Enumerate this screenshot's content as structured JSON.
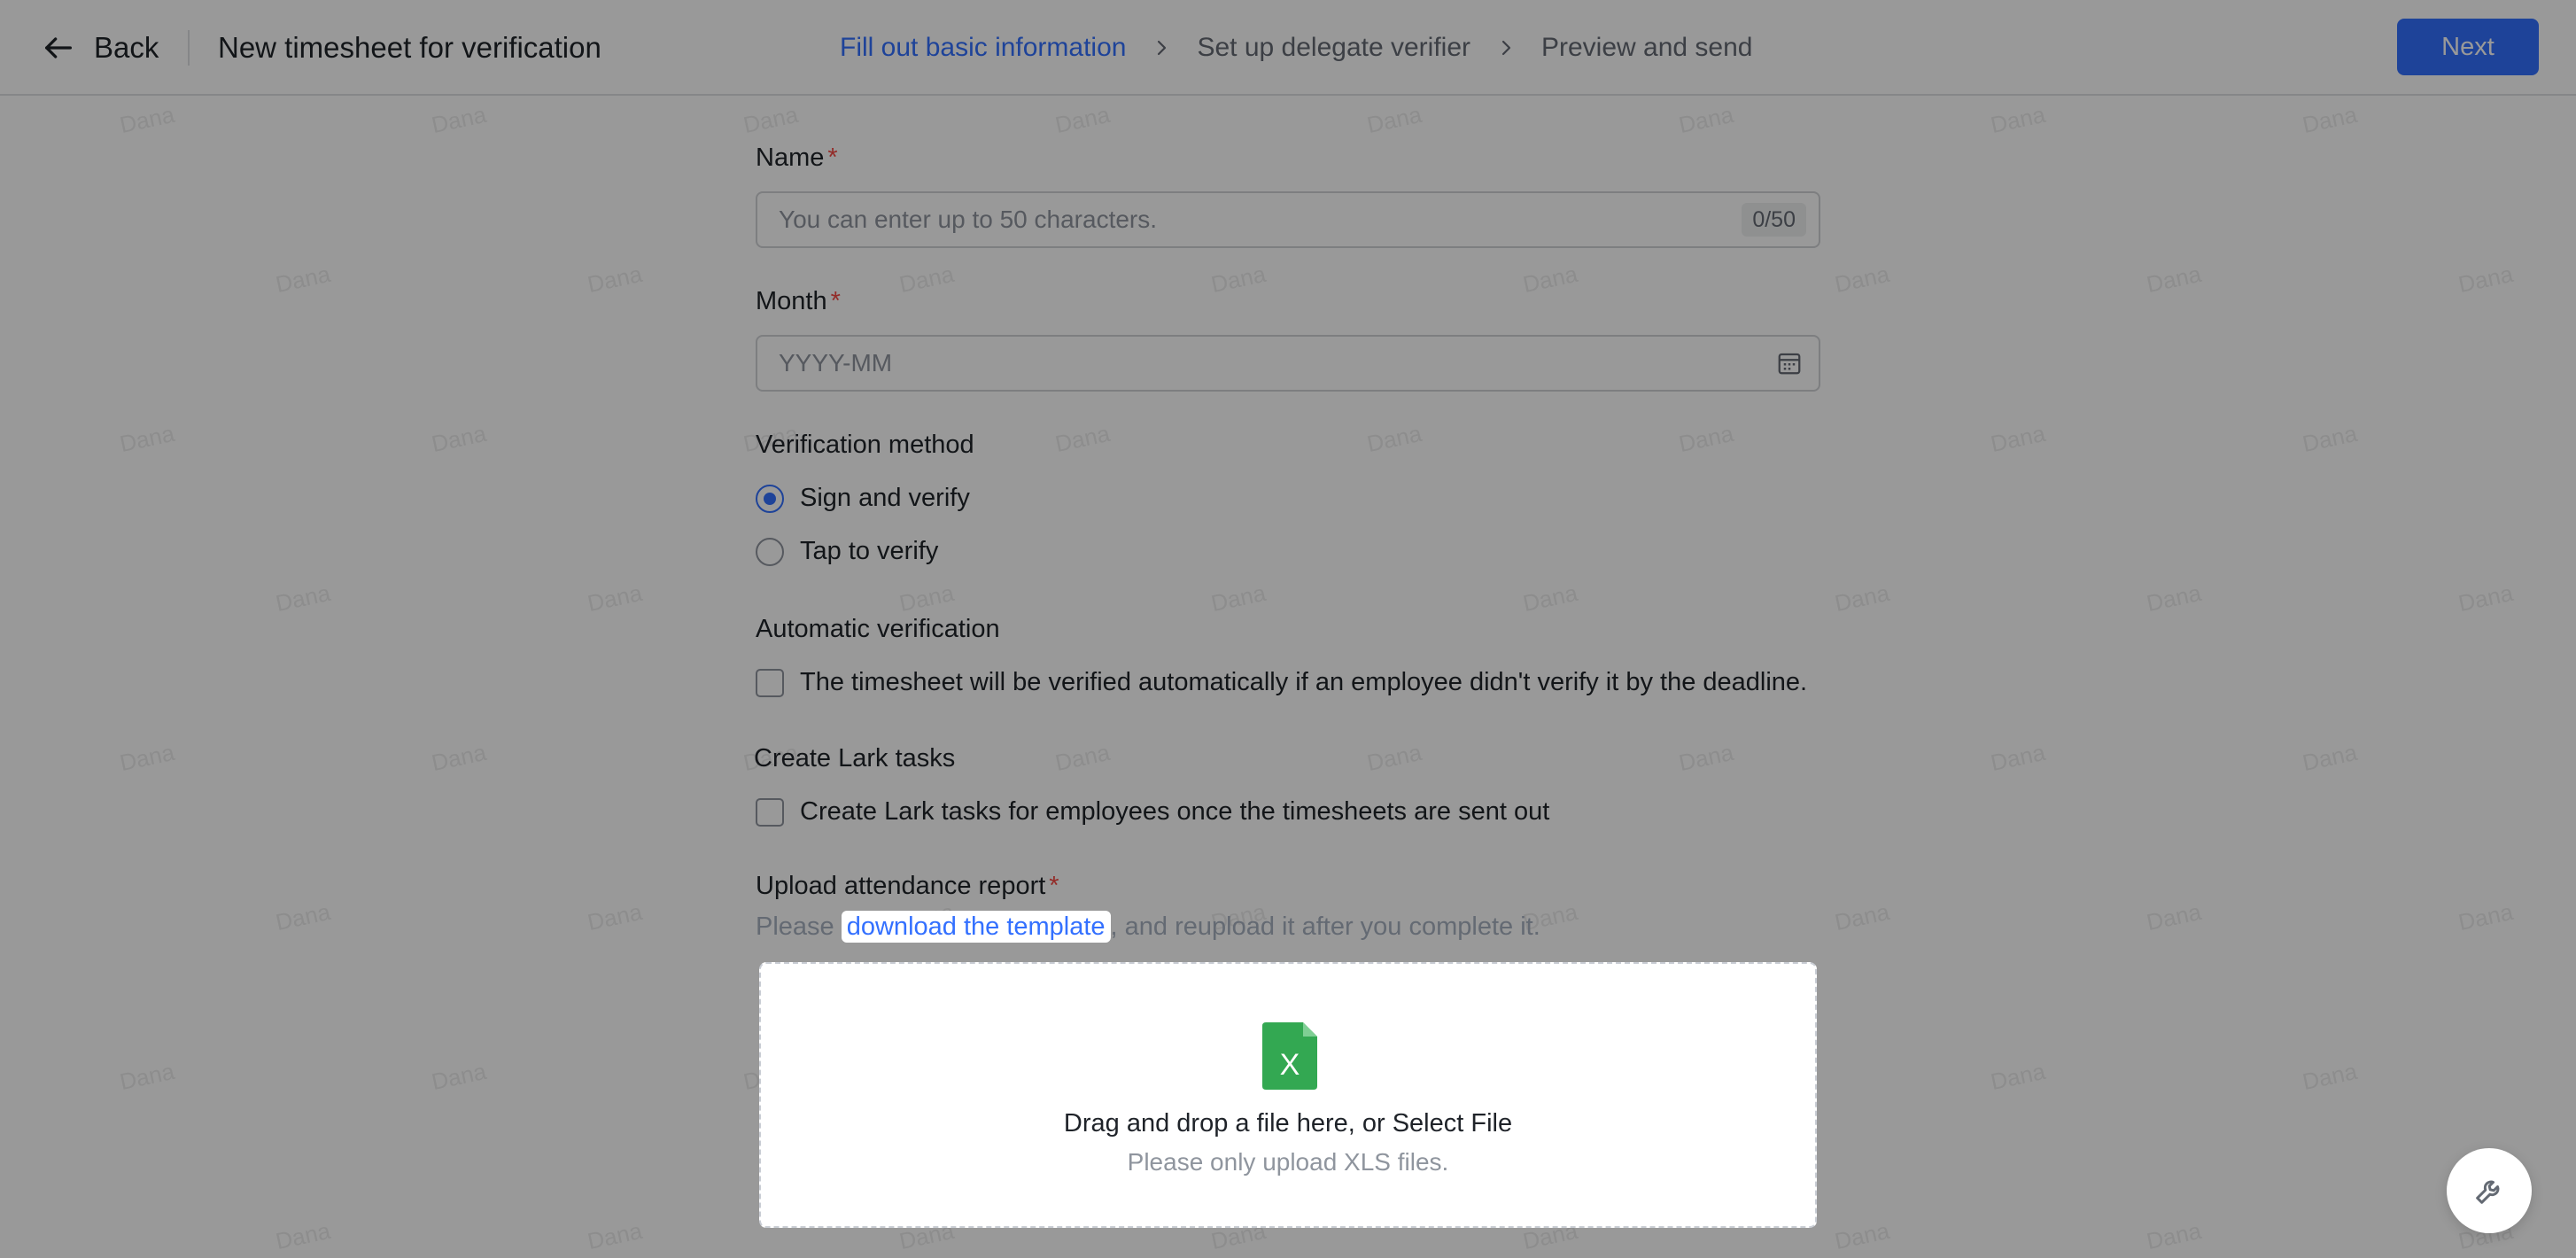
{
  "header": {
    "back_label": "Back",
    "title": "New timesheet for verification",
    "steps": [
      {
        "label": "Fill out basic information",
        "active": true
      },
      {
        "label": "Set up delegate verifier",
        "active": false
      },
      {
        "label": "Preview and send",
        "active": false
      }
    ],
    "next_label": "Next"
  },
  "form": {
    "name": {
      "label": "Name",
      "required_mark": "*",
      "placeholder": "You can enter up to 50 characters.",
      "value": "",
      "counter": "0/50"
    },
    "month": {
      "label": "Month",
      "required_mark": "*",
      "placeholder": "YYYY-MM",
      "value": ""
    },
    "verification_method": {
      "label": "Verification method",
      "options": [
        {
          "label": "Sign and verify",
          "checked": true
        },
        {
          "label": "Tap to verify",
          "checked": false
        }
      ]
    },
    "automatic_verification": {
      "label": "Automatic verification",
      "checkbox_label": "The timesheet will be verified automatically if an employee didn't verify it by the deadline.",
      "checked": false
    },
    "lark_tasks": {
      "label": "Create Lark tasks",
      "checkbox_label": "Create Lark tasks for employees once the timesheets are sent out",
      "checked": false
    },
    "upload": {
      "label": "Upload attendance report",
      "required_mark": "*",
      "hint_before": "Please ",
      "hint_link": "download the template",
      "hint_after": ", and reupload it after you complete it.",
      "file_icon_letter": "X",
      "drop_title": "Drag and drop a file here, or Select File",
      "drop_subtitle": "Please only upload XLS files."
    }
  },
  "watermark": "Dana",
  "colors": {
    "accent": "#3370ff",
    "required": "#f54a45",
    "excel_green": "#33a852"
  },
  "icons": {
    "back": "arrow-left-icon",
    "step_separator": "chevron-right-icon",
    "calendar": "calendar-icon",
    "file": "excel-file-icon",
    "tool": "wrench-icon"
  }
}
